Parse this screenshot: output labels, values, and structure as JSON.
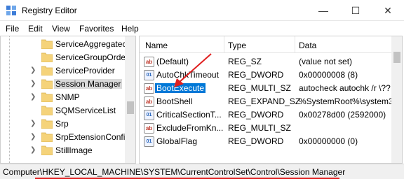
{
  "window": {
    "title": "Registry Editor"
  },
  "window_controls": {
    "minimize": "—",
    "maximize": "☐",
    "close": "✕"
  },
  "menu": [
    "File",
    "Edit",
    "View",
    "Favorites",
    "Help"
  ],
  "tree": {
    "items": [
      {
        "label": "ServiceAggregatec",
        "expandable": false,
        "selected": false
      },
      {
        "label": "ServiceGroupOrde",
        "expandable": false,
        "selected": false
      },
      {
        "label": "ServiceProvider",
        "expandable": true,
        "selected": false
      },
      {
        "label": "Session Manager",
        "expandable": true,
        "selected": true
      },
      {
        "label": "SNMP",
        "expandable": true,
        "selected": false
      },
      {
        "label": "SQMServiceList",
        "expandable": false,
        "selected": false
      },
      {
        "label": "Srp",
        "expandable": true,
        "selected": false
      },
      {
        "label": "SrpExtensionConfi",
        "expandable": true,
        "selected": false
      },
      {
        "label": "StillImage",
        "expandable": true,
        "selected": false
      }
    ]
  },
  "list": {
    "columns": [
      "Name",
      "Type",
      "Data"
    ],
    "rows": [
      {
        "icon": "ab",
        "name": "(Default)",
        "type": "REG_SZ",
        "data": "(value not set)",
        "selected": false
      },
      {
        "icon": "bin",
        "name": "AutoChkTimeout",
        "type": "REG_DWORD",
        "data": "0x00000008 (8)",
        "selected": false
      },
      {
        "icon": "ab",
        "name": "BootExecute",
        "type": "REG_MULTI_SZ",
        "data": "autocheck autochk /r \\??",
        "selected": true
      },
      {
        "icon": "ab",
        "name": "BootShell",
        "type": "REG_EXPAND_SZ",
        "data": "%SystemRoot%\\system3",
        "selected": false
      },
      {
        "icon": "bin",
        "name": "CriticalSectionT...",
        "type": "REG_DWORD",
        "data": "0x00278d00 (2592000)",
        "selected": false
      },
      {
        "icon": "ab",
        "name": "ExcludeFromKn...",
        "type": "REG_MULTI_SZ",
        "data": "",
        "selected": false
      },
      {
        "icon": "bin",
        "name": "GlobalFlag",
        "type": "REG_DWORD",
        "data": "0x00000000 (0)",
        "selected": false
      }
    ]
  },
  "status_bar": {
    "path": "Computer\\HKEY_LOCAL_MACHINE\\SYSTEM\\CurrentControlSet\\Control\\Session Manager"
  },
  "colors": {
    "selection": "#0078d7",
    "annotation": "#e02020",
    "folder": "#f5d37a"
  }
}
